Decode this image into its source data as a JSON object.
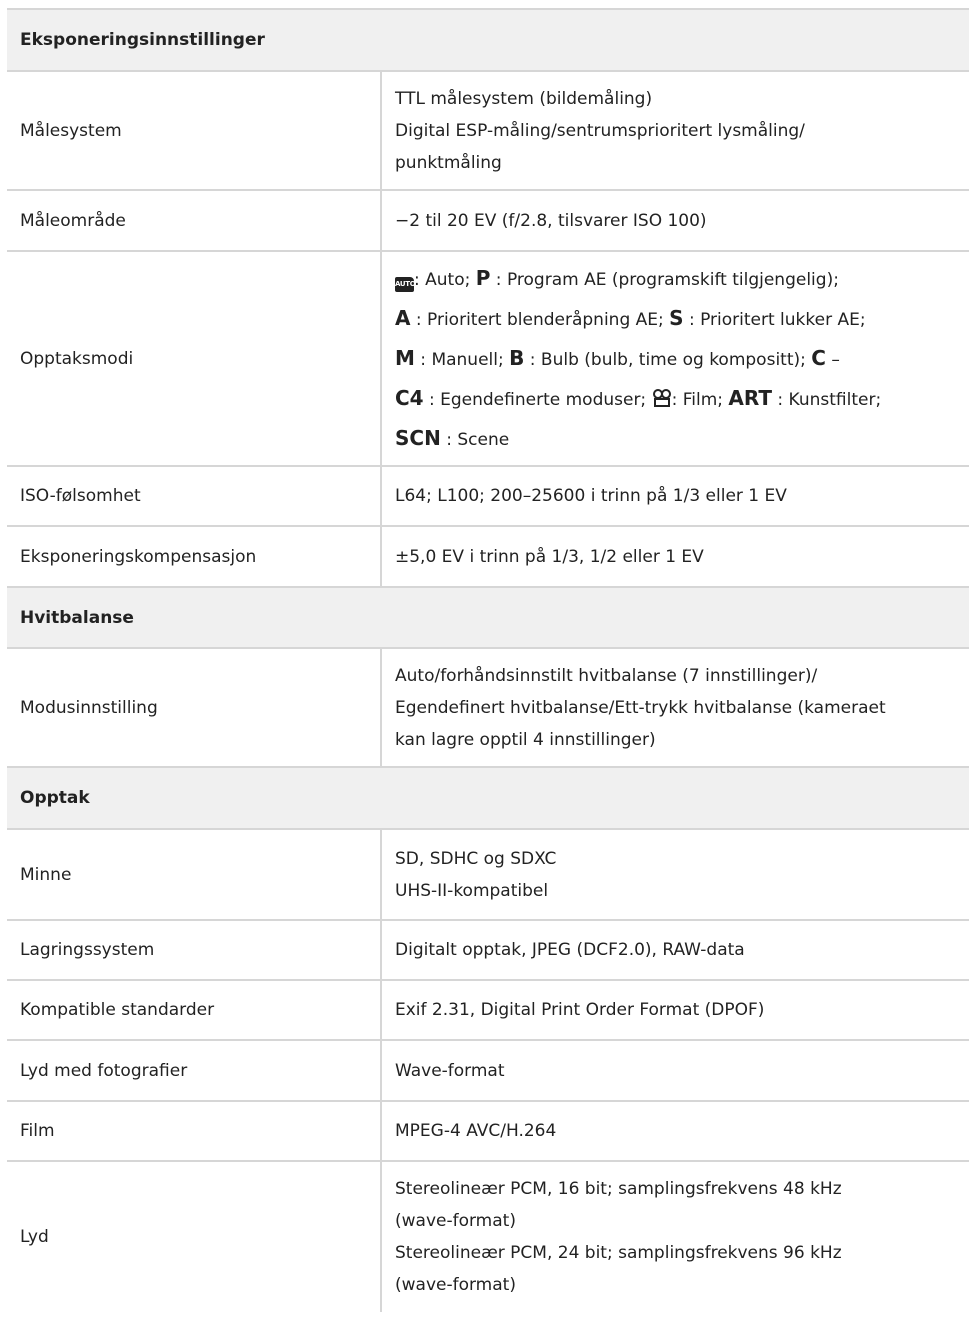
{
  "sections": {
    "exposure": "Eksponeringsinnstillinger",
    "wb": "Hvitbalanse",
    "recording": "Opptak"
  },
  "rows": {
    "metering": {
      "label": "Målesystem",
      "lines": [
        "TTL målesystem (bildemåling)",
        "Digital ESP-måling/sentrumsprioritert lysmåling/",
        "punktmåling"
      ]
    },
    "range": {
      "label": "Måleområde",
      "lines": [
        "−2 til 20 EV (f/2.8, tilsvarer ISO 100)"
      ]
    },
    "modes": {
      "label": "Opptaksmodi",
      "auto_icon": "AUTO",
      "l1a": ": Auto; ",
      "P": "P",
      "l1b": " : Program AE (programskift tilgjengelig);",
      "A": "A",
      "l2a": " : Prioritert blenderåpning AE; ",
      "S": "S",
      "l2b": " : Prioritert lukker AE;",
      "M": "M",
      "l3a": " : Manuell; ",
      "B": "B",
      "l3b": " : Bulb (bulb, time og kompositt); ",
      "C": "C",
      "l3c": " –",
      "C4": "C4",
      "l4a": " : Egendefinerte moduser; ",
      "l4b": ": Film; ",
      "ART": "ART",
      "l4c": " : Kunstfilter;",
      "SCN": "SCN",
      "l5a": " : Scene"
    },
    "iso": {
      "label": "ISO-følsomhet",
      "lines": [
        "L64; L100; 200–25600 i trinn på 1/3 eller 1 EV"
      ]
    },
    "comp": {
      "label": "Eksponeringskompensasjon",
      "lines": [
        "±5,0 EV i trinn på 1/3, 1/2 eller 1 EV"
      ]
    },
    "wbmode": {
      "label": "Modusinnstilling",
      "lines": [
        "Auto/forhåndsinnstilt hvitbalanse (7 innstillinger)/",
        "Egendefinert hvitbalanse/Ett-trykk hvitbalanse (kameraet",
        "kan lagre opptil 4 innstillinger)"
      ]
    },
    "memory": {
      "label": "Minne",
      "lines": [
        "SD, SDHC og SDXC",
        "UHS-II-kompatibel"
      ]
    },
    "storage": {
      "label": "Lagringssystem",
      "lines": [
        "Digitalt opptak, JPEG (DCF2.0), RAW-data"
      ]
    },
    "standards": {
      "label": "Kompatible standarder",
      "lines": [
        "Exif 2.31, Digital Print Order Format (DPOF)"
      ]
    },
    "photoaudio": {
      "label": "Lyd med fotografier",
      "lines": [
        "Wave-format"
      ]
    },
    "film": {
      "label": "Film",
      "lines": [
        "MPEG-4 AVC/H.264"
      ]
    },
    "audio": {
      "label": "Lyd",
      "lines": [
        "Stereolineær PCM, 16 bit; samplingsfrekvens 48 kHz",
        "(wave-format)",
        "Stereolineær PCM, 24 bit; samplingsfrekvens 96 kHz",
        "(wave-format)"
      ]
    }
  }
}
